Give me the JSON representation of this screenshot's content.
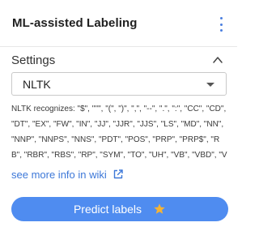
{
  "header": {
    "title": "ML-assisted Labeling",
    "menu_icon": "more-vertical-icon"
  },
  "settings": {
    "label": "Settings",
    "toggle_icon": "chevron-up-icon"
  },
  "select": {
    "value": "NLTK",
    "caret_icon": "caret-down-icon"
  },
  "description": "NLTK recognizes: \"$\", \"''\", \"(\", \")\", \",\", \"--\", \".\", \":\", \"CC\", \"CD\", \"DT\", \"EX\", \"FW\", \"IN\", \"JJ\", \"JJR\", \"JJS\", \"LS\", \"MD\", \"NN\", \"NNP\", \"NNPS\", \"NNS\", \"PDT\", \"POS\", \"PRP\", \"PRP$\", \"RB\", \"RBR\", \"RBS\", \"RP\", \"SYM\", \"TO\", \"UH\", \"VB\", \"VBD\", \"VBG\", \"VBN...",
  "wiki_link": {
    "text": "see more info in wiki",
    "icon": "external-link-icon"
  },
  "predict_button": {
    "label": "Predict labels",
    "icon": "star-icon"
  },
  "colors": {
    "accent": "#4f8cf0",
    "link": "#3d78d8",
    "star": "#f5b335"
  }
}
